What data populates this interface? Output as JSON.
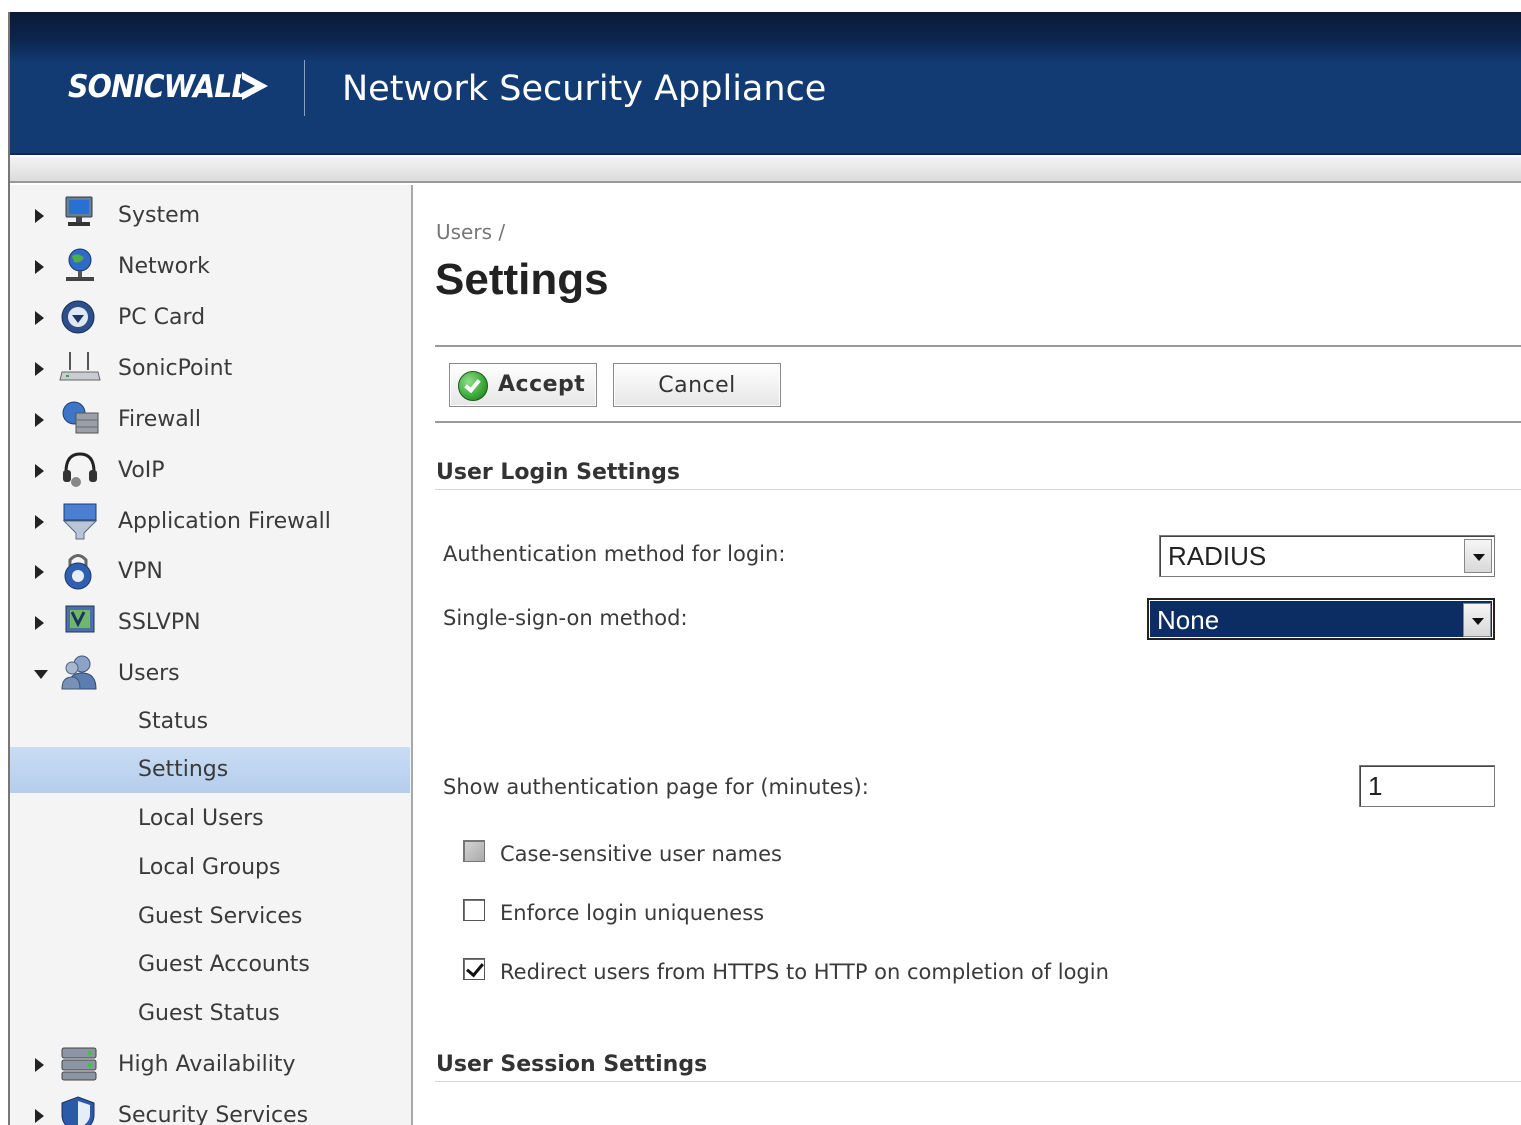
{
  "header": {
    "logo_text": "SONICWALL",
    "app_title": "Network Security Appliance"
  },
  "sidebar": {
    "items": [
      {
        "label": "System",
        "icon": "monitor-icon",
        "expanded": false
      },
      {
        "label": "Network",
        "icon": "globe-network-icon",
        "expanded": false
      },
      {
        "label": "PC Card",
        "icon": "pc-card-icon",
        "expanded": false
      },
      {
        "label": "SonicPoint",
        "icon": "wireless-access-point-icon",
        "expanded": false
      },
      {
        "label": "Firewall",
        "icon": "firewall-globe-icon",
        "expanded": false
      },
      {
        "label": "VoIP",
        "icon": "headset-icon",
        "expanded": false
      },
      {
        "label": "Application Firewall",
        "icon": "application-firewall-icon",
        "expanded": false
      },
      {
        "label": "VPN",
        "icon": "vpn-lock-icon",
        "expanded": false
      },
      {
        "label": "SSLVPN",
        "icon": "sslvpn-icon",
        "expanded": false
      },
      {
        "label": "Users",
        "icon": "users-icon",
        "expanded": true
      }
    ],
    "users_subitems": [
      {
        "label": "Status",
        "selected": false
      },
      {
        "label": "Settings",
        "selected": true
      },
      {
        "label": "Local Users",
        "selected": false
      },
      {
        "label": "Local Groups",
        "selected": false
      },
      {
        "label": "Guest Services",
        "selected": false
      },
      {
        "label": "Guest Accounts",
        "selected": false
      },
      {
        "label": "Guest Status",
        "selected": false
      }
    ],
    "items_after": [
      {
        "label": "High Availability",
        "icon": "server-rack-icon",
        "expanded": false
      },
      {
        "label": "Security Services",
        "icon": "shield-icon",
        "expanded": false
      }
    ]
  },
  "main": {
    "breadcrumb": "Users /",
    "title": "Settings",
    "toolbar": {
      "accept_label": "Accept",
      "cancel_label": "Cancel"
    },
    "login_section": {
      "title": "User Login Settings",
      "auth_method_label": "Authentication method for login:",
      "auth_method_value": "RADIUS",
      "sso_label": "Single-sign-on method:",
      "sso_value": "None",
      "auth_page_label": "Show authentication page for (minutes):",
      "auth_page_value": "1",
      "checkboxes": [
        {
          "label": "Case-sensitive user names",
          "checked": false,
          "disabled": true
        },
        {
          "label": "Enforce login uniqueness",
          "checked": false,
          "disabled": false
        },
        {
          "label": "Redirect users from HTTPS to HTTP on completion of login",
          "checked": true,
          "disabled": false
        }
      ]
    },
    "session_section": {
      "title": "User Session Settings"
    }
  },
  "colors": {
    "header_bg": "#123a73",
    "selected_nav_bg": "#c0d6f0",
    "select_highlight": "#0c2c64"
  }
}
